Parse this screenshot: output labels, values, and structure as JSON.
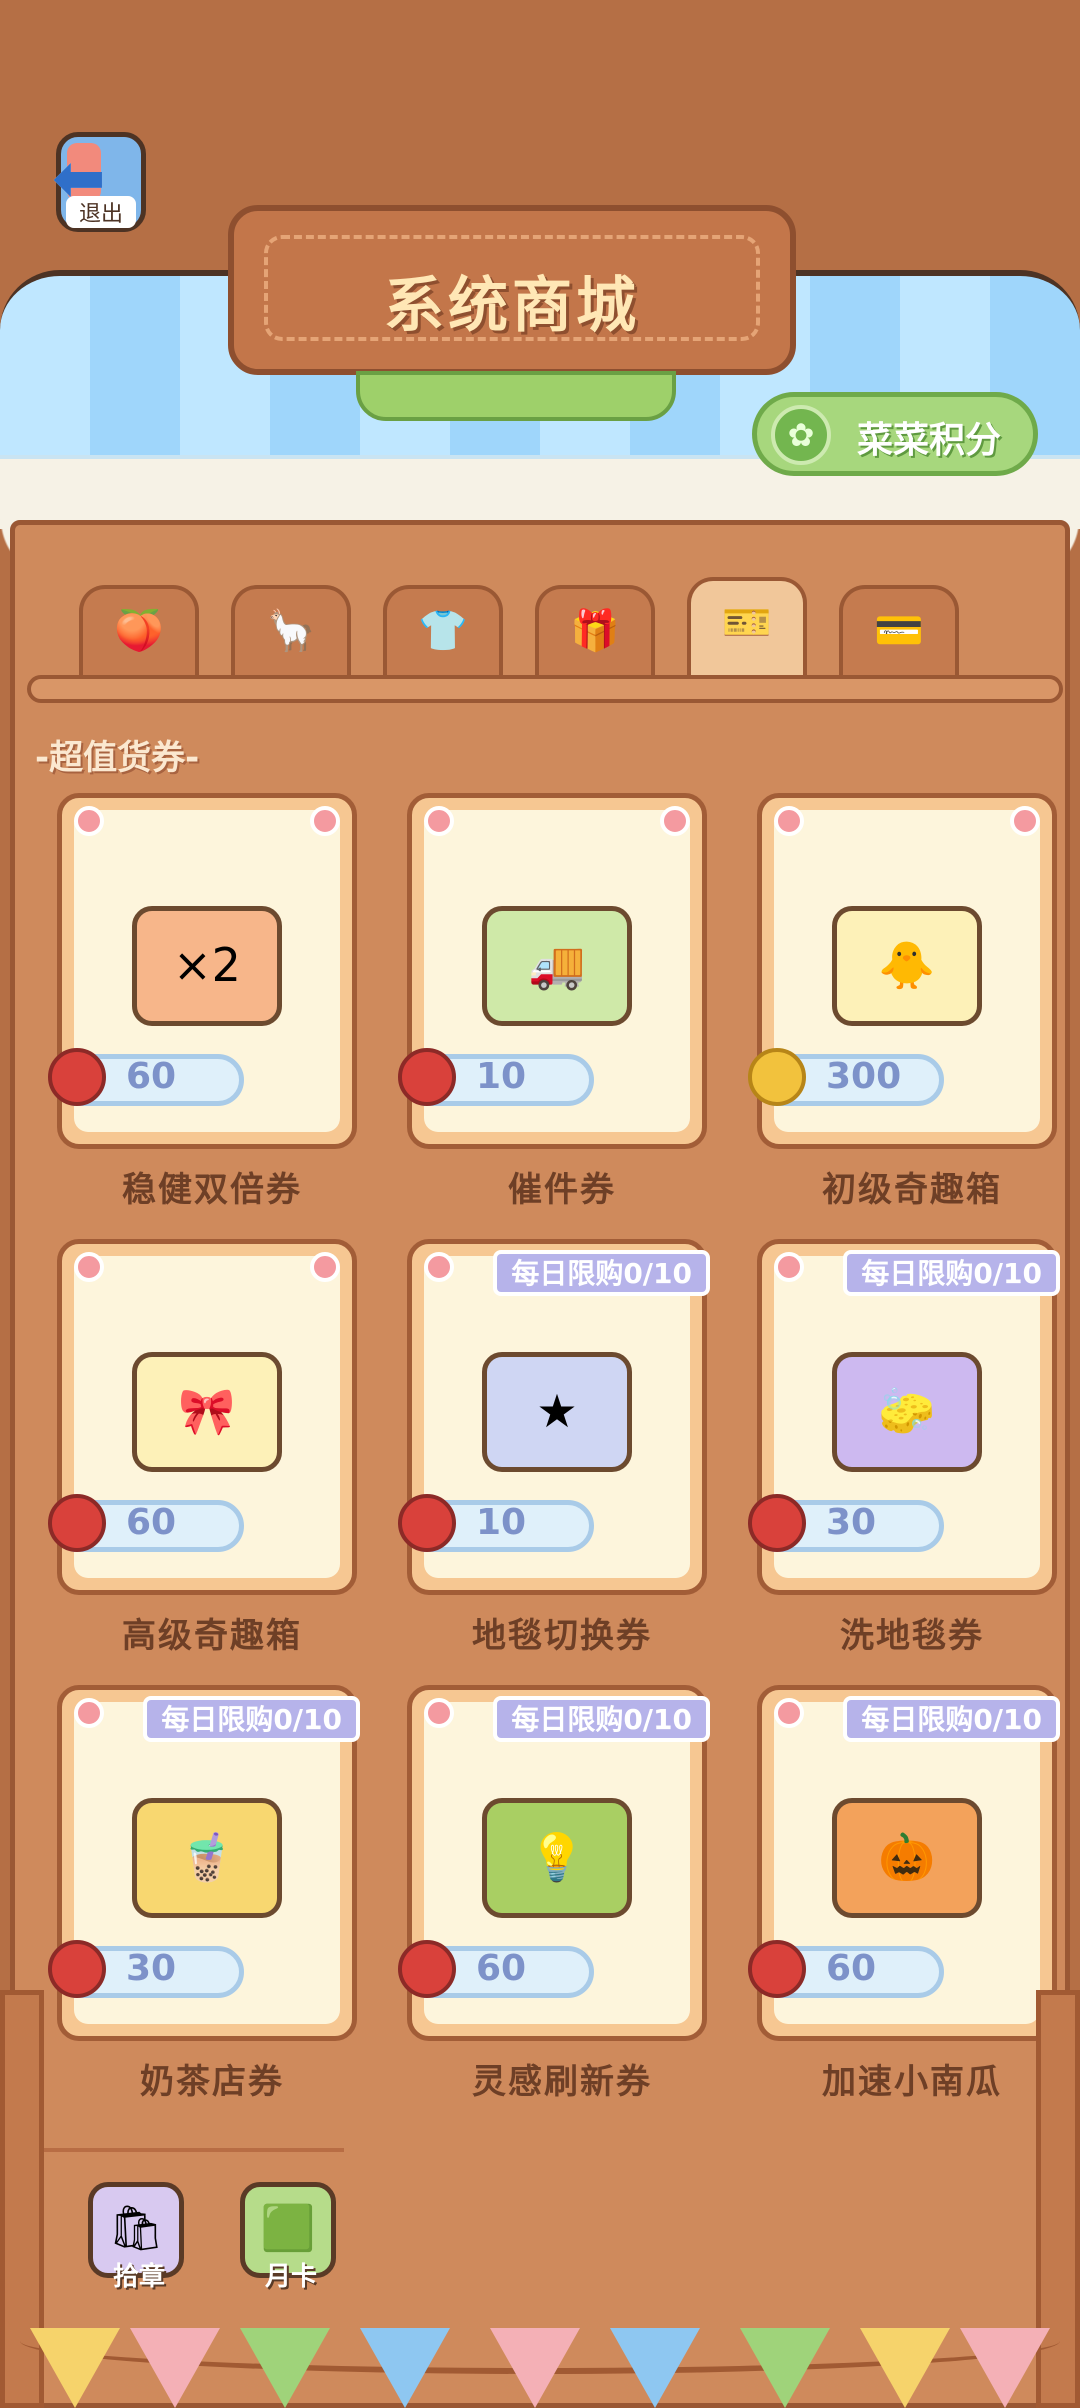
{
  "header": {
    "exit_label": "退出",
    "title": "系统商城",
    "points_label": "菜菜积分"
  },
  "tabs": [
    {
      "icon": "fruit-icon",
      "glyph": "🍑",
      "active": false
    },
    {
      "icon": "animal-icon",
      "glyph": "🦙",
      "active": false
    },
    {
      "icon": "shirt-icon",
      "glyph": "👕",
      "active": false
    },
    {
      "icon": "gift-icon",
      "glyph": "🎁",
      "active": false
    },
    {
      "icon": "voucher-icon",
      "glyph": "🎫",
      "active": true
    },
    {
      "icon": "card-icon",
      "glyph": "💳",
      "active": false
    }
  ],
  "section_title": "-超值货券-",
  "items": [
    {
      "name": "稳健双倍券",
      "price": "60",
      "currency": "cherry",
      "limit": "",
      "glyph": "×2",
      "color": "#f7b68a"
    },
    {
      "name": "催件券",
      "price": "10",
      "currency": "cherry",
      "limit": "",
      "glyph": "🚚",
      "color": "#cfe9a8"
    },
    {
      "name": "初级奇趣箱",
      "price": "300",
      "currency": "coin",
      "limit": "",
      "glyph": "🐥",
      "color": "#fdf1b8"
    },
    {
      "name": "高级奇趣箱",
      "price": "60",
      "currency": "cherry",
      "limit": "",
      "glyph": "🎀",
      "color": "#fdf1b8"
    },
    {
      "name": "地毯切换券",
      "price": "10",
      "currency": "cherry",
      "limit": "每日限购0/10",
      "glyph": "★",
      "color": "#cfd6f3"
    },
    {
      "name": "洗地毯券",
      "price": "30",
      "currency": "cherry",
      "limit": "每日限购0/10",
      "glyph": "🧽",
      "color": "#cdb9f0"
    },
    {
      "name": "奶茶店券",
      "price": "30",
      "currency": "cherry",
      "limit": "每日限购0/10",
      "glyph": "🧋",
      "color": "#f8d770"
    },
    {
      "name": "灵感刷新券",
      "price": "60",
      "currency": "cherry",
      "limit": "每日限购0/10",
      "glyph": "💡",
      "color": "#a9cf63"
    },
    {
      "name": "加速小南瓜",
      "price": "60",
      "currency": "cherry",
      "limit": "每日限购0/10",
      "glyph": "🎃",
      "color": "#f3a25b"
    }
  ],
  "bottom_buttons": [
    {
      "label": "拾章",
      "icon": "badge-bag-icon",
      "glyph": "🛍",
      "color": "#d8c9f0"
    },
    {
      "label": "月卡",
      "icon": "month-card-icon",
      "glyph": "🟩",
      "color": "#b6dc8a"
    }
  ],
  "colors": {
    "wood": "#b56f45",
    "panel": "#cf8a5c",
    "accent_green": "#a7d77d",
    "price_text": "#7d92c9",
    "limit_badge": "#b6b3ea"
  }
}
